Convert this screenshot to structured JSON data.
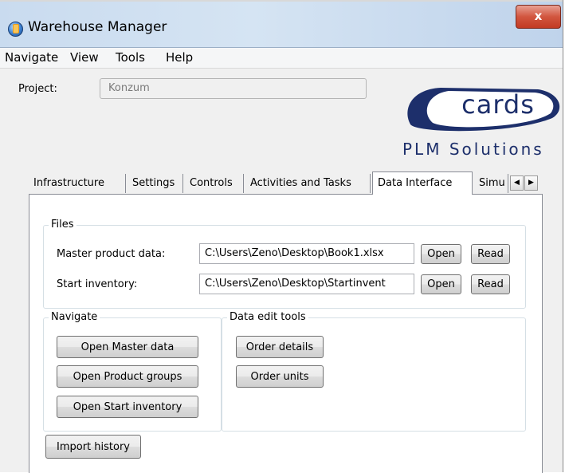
{
  "window": {
    "title": "Warehouse Manager",
    "close_symbol": "x",
    "accent": "#c23a23"
  },
  "menu": {
    "items": [
      "Navigate",
      "View",
      "Tools",
      "Help"
    ]
  },
  "project": {
    "label": "Project:",
    "value": "Konzum"
  },
  "logo": {
    "word": "cards",
    "subtitle": "PLM Solutions",
    "color": "#1d2f6b"
  },
  "tabs": {
    "items": [
      "Infrastructure",
      "Settings",
      "Controls",
      "Activities and Tasks",
      "Data Interface",
      "Simu"
    ],
    "active": "Data Interface",
    "scroll_left_icon": "chevron-left-icon",
    "scroll_right_icon": "chevron-right-icon"
  },
  "files": {
    "title": "Files",
    "rows": [
      {
        "label": "Master product data:",
        "path": "C:\\Users\\Zeno\\Desktop\\Book1.xlsx",
        "open": "Open",
        "read": "Read"
      },
      {
        "label": "Start inventory:",
        "path": "C:\\Users\\Zeno\\Desktop\\Startinvent",
        "open": "Open",
        "read": "Read"
      }
    ]
  },
  "navigate": {
    "title": "Navigate",
    "buttons": [
      "Open Master data",
      "Open Product groups",
      "Open Start inventory"
    ]
  },
  "data_edit": {
    "title": "Data edit tools",
    "buttons": [
      "Order details",
      "Order units"
    ]
  },
  "import_history": "Import history"
}
